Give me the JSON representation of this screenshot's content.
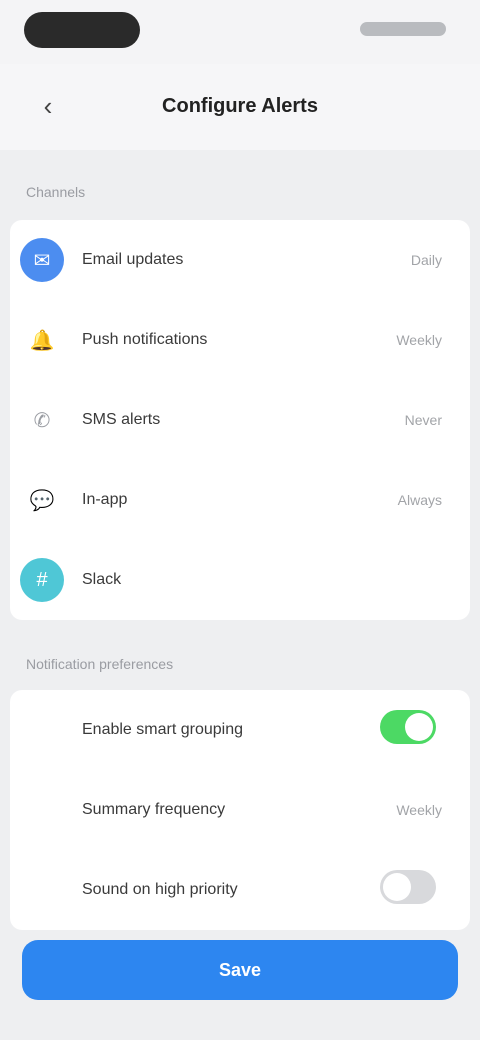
{
  "status_bar": {},
  "nav": {
    "back_icon": "chevron-left-icon",
    "title": "Configure Alerts"
  },
  "sections": {
    "channels_label": "Channels",
    "preferences_label": "Notification preferences"
  },
  "channels": [
    {
      "icon": "email-icon",
      "icon_color": "#4c8df0",
      "label": "Email updates",
      "value": "Daily"
    },
    {
      "icon": "bell-icon",
      "icon_color": "",
      "label": "Push notifications",
      "value": "Weekly"
    },
    {
      "icon": "sms-icon",
      "icon_color": "",
      "label": "SMS alerts",
      "value": "Never"
    },
    {
      "icon": "chat-icon",
      "icon_color": "",
      "label": "In-app",
      "value": "Always"
    },
    {
      "icon": "slack-icon",
      "icon_color": "#4fc7d6",
      "label": "Slack",
      "value": ""
    }
  ],
  "preferences": [
    {
      "label": "Enable smart grouping",
      "control": "toggle",
      "state": true,
      "accent": "#4cd964"
    },
    {
      "label": "Summary frequency",
      "control": "value",
      "value": "Weekly"
    },
    {
      "label": "Sound on high priority",
      "control": "toggle",
      "state": false,
      "accent": "#d8d9dc"
    }
  ],
  "footer": {
    "primary_label": "Save"
  }
}
